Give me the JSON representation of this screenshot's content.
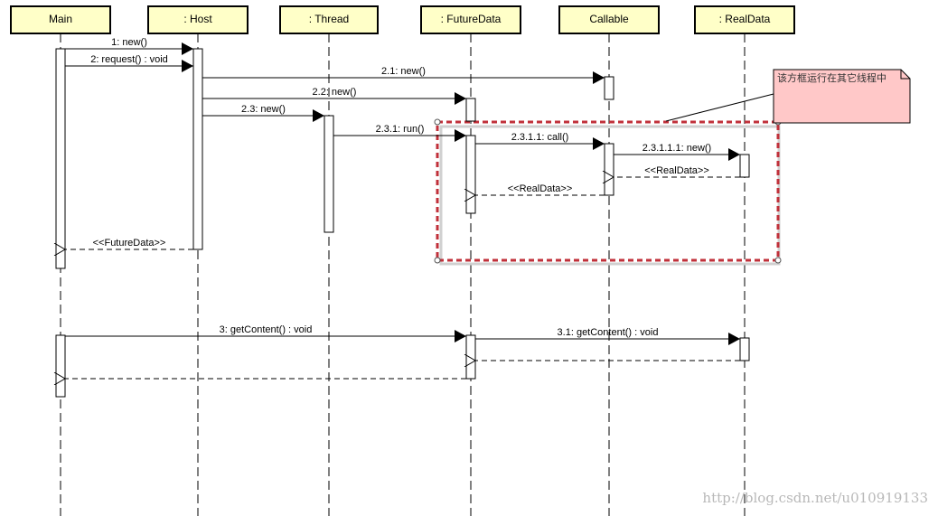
{
  "participants": [
    {
      "id": "main",
      "label": "Main"
    },
    {
      "id": "host",
      "label": ": Host"
    },
    {
      "id": "thread",
      "label": ": Thread"
    },
    {
      "id": "futuredata",
      "label": ": FutureData"
    },
    {
      "id": "callable",
      "label": "Callable"
    },
    {
      "id": "realdata",
      "label": ": RealData"
    }
  ],
  "messages": [
    {
      "label": "1: new()",
      "from": "main",
      "to": "host",
      "kind": "sync"
    },
    {
      "label": "2: request() : void",
      "from": "main",
      "to": "host",
      "kind": "sync"
    },
    {
      "label": "2.1: new()",
      "from": "host",
      "to": "callable",
      "kind": "sync"
    },
    {
      "label": "2.2: new()",
      "from": "host",
      "to": "futuredata",
      "kind": "sync"
    },
    {
      "label": "2.3: new()",
      "from": "host",
      "to": "thread",
      "kind": "sync"
    },
    {
      "label": "2.3.1: run()",
      "from": "thread",
      "to": "futuredata",
      "kind": "sync"
    },
    {
      "label": "2.3.1.1: call()",
      "from": "futuredata",
      "to": "callable",
      "kind": "sync"
    },
    {
      "label": "2.3.1.1.1: new()",
      "from": "callable",
      "to": "realdata",
      "kind": "sync"
    },
    {
      "label": "<<RealData>>",
      "from": "realdata",
      "to": "callable",
      "kind": "return"
    },
    {
      "label": "<<RealData>>",
      "from": "callable",
      "to": "futuredata",
      "kind": "return"
    },
    {
      "label": "<<FutureData>>",
      "from": "host",
      "to": "main",
      "kind": "return"
    },
    {
      "label": "3: getContent() : void",
      "from": "main",
      "to": "futuredata",
      "kind": "sync"
    },
    {
      "label": "3.1: getContent() : void",
      "from": "futuredata",
      "to": "realdata",
      "kind": "sync"
    },
    {
      "label": "",
      "from": "realdata",
      "to": "futuredata",
      "kind": "return"
    },
    {
      "label": "",
      "from": "futuredata",
      "to": "main",
      "kind": "return"
    }
  ],
  "note": {
    "text": "该方框运行在其它线程中"
  },
  "watermark": "http://blog.csdn.net/u010919133",
  "colors": {
    "header_fill": "#ffffc8",
    "note_fill": "#ffc8c8",
    "frame_border": "#c0303a",
    "frame_inner": "#d0d0d0"
  }
}
